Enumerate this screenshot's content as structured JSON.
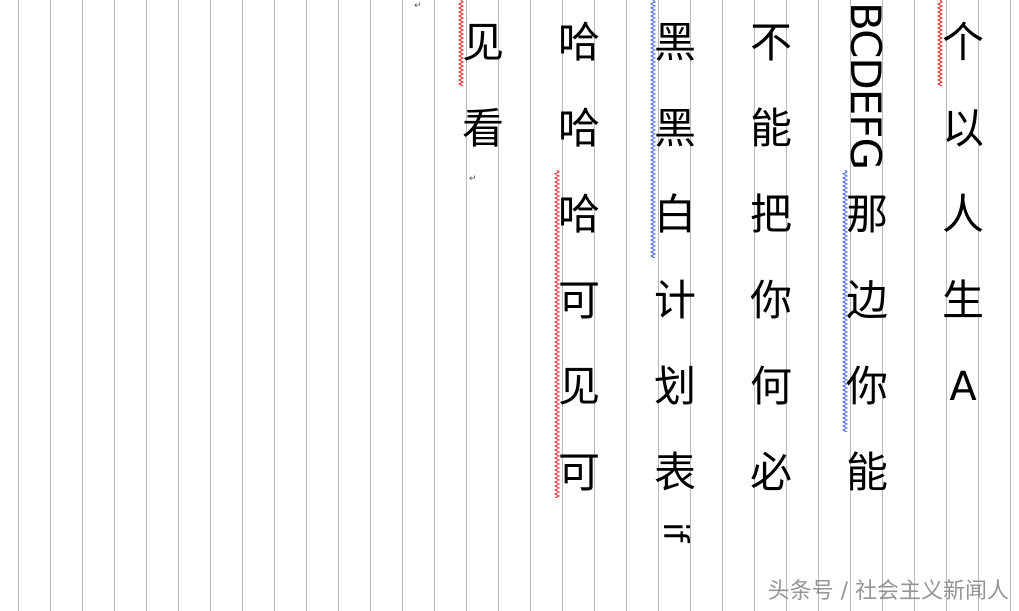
{
  "columns": [
    {
      "id": "col1",
      "chars": [
        "个",
        "以",
        "人",
        "生",
        "A"
      ]
    },
    {
      "id": "col2",
      "rotated_text": "BCDEFG",
      "chars": [
        "那",
        "边",
        "你",
        "能"
      ]
    },
    {
      "id": "col3",
      "chars": [
        "不",
        "能",
        "把",
        "你",
        "何",
        "必"
      ]
    },
    {
      "id": "col4",
      "chars": [
        "黑",
        "黑",
        "白",
        "计",
        "划",
        "表"
      ],
      "rotated_text": "if"
    },
    {
      "id": "col5",
      "chars": [
        "哈",
        "哈",
        "哈",
        "可",
        "见",
        "可"
      ]
    },
    {
      "id": "col6",
      "chars": [
        "见",
        "看"
      ]
    }
  ],
  "paragraph_mark": "↵",
  "watermark": "头条号 / 社会主义新闻人",
  "colors": {
    "gridline": "#b9b9b9",
    "text": "#000000",
    "spell_red": "#e02020",
    "grammar_blue": "#3a5fd0",
    "watermark": "#8a8a8a"
  }
}
